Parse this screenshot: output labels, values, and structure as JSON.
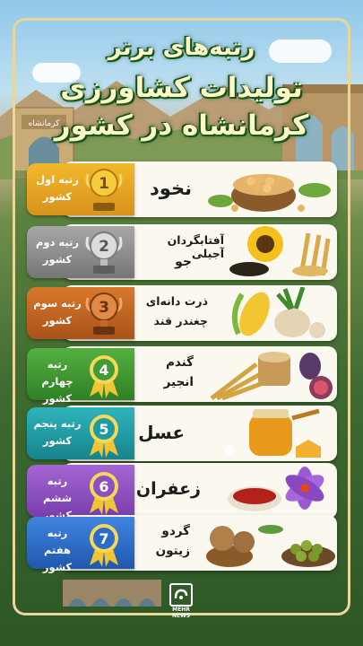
{
  "title": {
    "line1": "رتبه‌های برتر",
    "line2": "تولیدات کشاورزی",
    "line3": "کرمانشاه در کشور"
  },
  "background": {
    "sign_text": "کرمانشاه"
  },
  "ranks": [
    {
      "rank": "1",
      "label": "رتبه اول کشور",
      "products": [
        "نخود"
      ],
      "color": "#e6a81c",
      "medal": "gold-trophy"
    },
    {
      "rank": "2",
      "label": "رتبه دوم کشور",
      "products": [
        "آفتابگردان آجیلی",
        "جو"
      ],
      "color": "#8c8c8c",
      "medal": "silver-trophy"
    },
    {
      "rank": "3",
      "label": "رتبه سوم کشور",
      "products": [
        "ذرت دانه‌ای",
        "چغندر قند"
      ],
      "color": "#c0671f",
      "medal": "bronze-trophy"
    },
    {
      "rank": "4",
      "label": "رتبه چهارم کشور",
      "products": [
        "گندم",
        "انجیر"
      ],
      "color": "#3f9b32",
      "medal": "green-ribbon-medal"
    },
    {
      "rank": "5",
      "label": "رتبه پنجم کشور",
      "products": [
        "عسل"
      ],
      "color": "#1e9aa2",
      "medal": "teal-ribbon-medal"
    },
    {
      "rank": "6",
      "label": "رتبه ششم کشور",
      "products": [
        "زعفران"
      ],
      "color": "#8e4fbf",
      "medal": "purple-ribbon-medal"
    },
    {
      "rank": "7",
      "label": "رتبه هفتم کشور",
      "products": [
        "گردو",
        "زیتون"
      ],
      "color": "#2c6cc8",
      "medal": "blue-ribbon-medal"
    }
  ],
  "logo": {
    "line1": "MEHR",
    "line2": "NEWS"
  }
}
